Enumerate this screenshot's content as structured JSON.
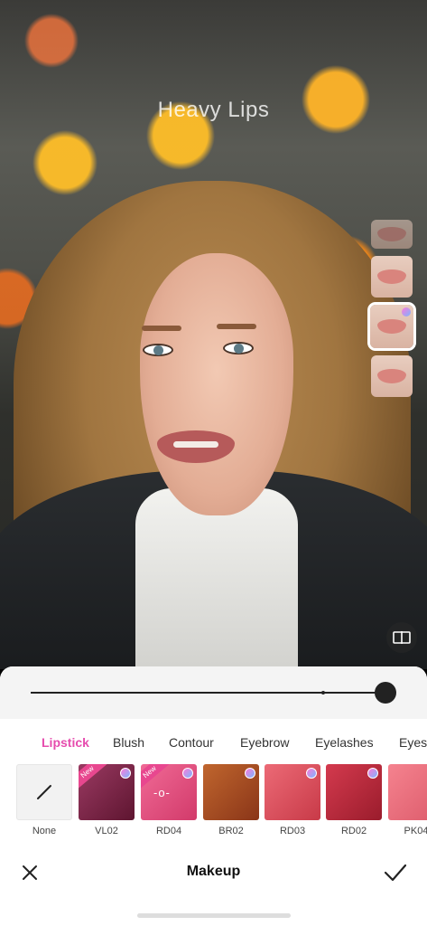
{
  "overlay": {
    "title": "Heavy Lips"
  },
  "styles": [
    {
      "name": "style-1",
      "state": "faded"
    },
    {
      "name": "style-2",
      "state": "normal"
    },
    {
      "name": "style-3",
      "state": "selected",
      "premium": true
    },
    {
      "name": "style-4",
      "state": "normal"
    }
  ],
  "slider": {
    "value": 1.0
  },
  "tabs": [
    {
      "label": "Lipstick",
      "active": true
    },
    {
      "label": "Blush"
    },
    {
      "label": "Contour"
    },
    {
      "label": "Eyebrow"
    },
    {
      "label": "Eyelashes"
    },
    {
      "label": "Eyes"
    }
  ],
  "swatches": [
    {
      "label": "None",
      "color": "#f2f2f2",
      "new": false,
      "premium": false,
      "icon": "slash-icon"
    },
    {
      "label": "VL02",
      "color": "#7a2040",
      "new": true,
      "new_label": "New",
      "premium": true
    },
    {
      "label": "RD04",
      "color": "#e04a7a",
      "new": true,
      "new_label": "New",
      "premium": true,
      "mark": "-o-"
    },
    {
      "label": "BR02",
      "color": "#a44a22",
      "new": false,
      "premium": true
    },
    {
      "label": "RD03",
      "color": "#d84a58",
      "new": false,
      "premium": true
    },
    {
      "label": "RD02",
      "color": "#b8283a",
      "new": false,
      "premium": true
    },
    {
      "label": "PK04",
      "color": "#e86a7a",
      "new": false,
      "premium": false
    }
  ],
  "bottom_bar": {
    "title": "Makeup"
  },
  "colors": {
    "accent": "#e64cae"
  }
}
